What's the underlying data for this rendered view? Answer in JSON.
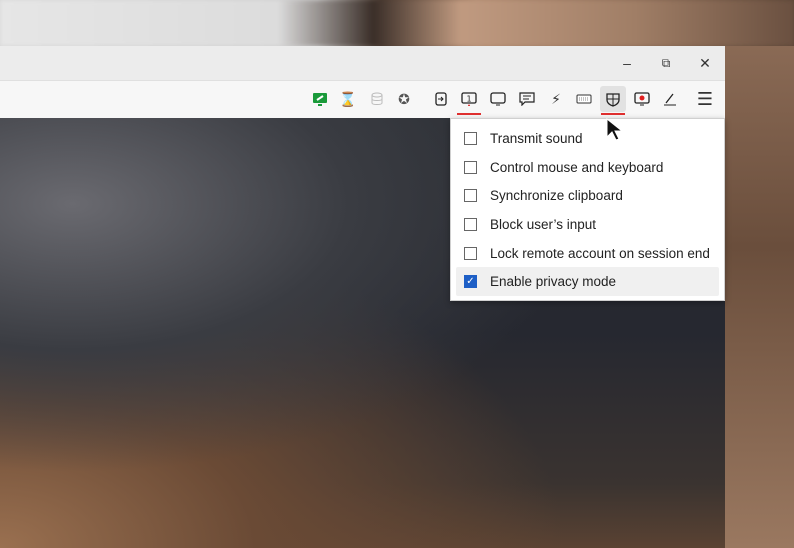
{
  "window": {
    "minimize_icon": "minimize-icon",
    "restore_icon": "restore-icon",
    "close_icon": "close-icon"
  },
  "toolbar": {
    "items": [
      {
        "name": "connection-status-icon"
      },
      {
        "name": "hourglass-icon"
      },
      {
        "name": "database-icon"
      },
      {
        "name": "star-icon"
      },
      {
        "name": "session-login-icon"
      },
      {
        "name": "monitor-1-icon",
        "label": "1"
      },
      {
        "name": "display-icon"
      },
      {
        "name": "chat-icon"
      },
      {
        "name": "lightning-icon"
      },
      {
        "name": "keyboard-icon"
      },
      {
        "name": "shield-icon"
      },
      {
        "name": "record-icon"
      },
      {
        "name": "pen-icon"
      },
      {
        "name": "menu-icon"
      }
    ],
    "accent": "#e03030"
  },
  "menu": {
    "items": [
      {
        "label": "Transmit sound",
        "checked": false
      },
      {
        "label": "Control mouse and keyboard",
        "checked": false
      },
      {
        "label": "Synchronize clipboard",
        "checked": false
      },
      {
        "label": "Block user’s input",
        "checked": false
      },
      {
        "label": "Lock remote account on session end",
        "checked": false
      },
      {
        "label": "Enable privacy mode",
        "checked": true
      }
    ],
    "check_color": "#1e5fc6"
  }
}
